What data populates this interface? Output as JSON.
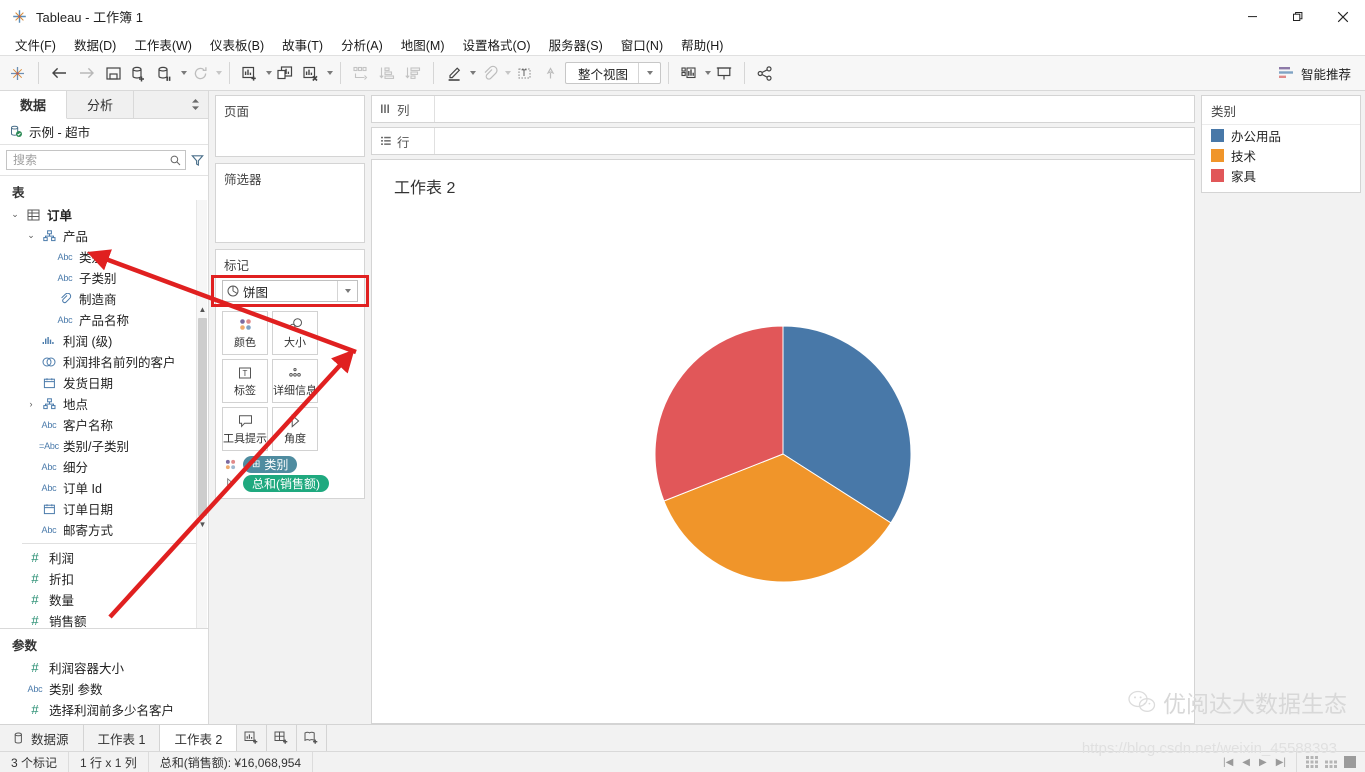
{
  "window": {
    "title": "Tableau - 工作簿 1",
    "logo_icon": "tableau-logo-icon",
    "minimize": "—",
    "maximize": "❐",
    "close": "✕"
  },
  "menubar": {
    "items": [
      {
        "label": "文件(F)"
      },
      {
        "label": "数据(D)"
      },
      {
        "label": "工作表(W)"
      },
      {
        "label": "仪表板(B)"
      },
      {
        "label": "故事(T)"
      },
      {
        "label": "分析(A)"
      },
      {
        "label": "地图(M)"
      },
      {
        "label": "设置格式(O)"
      },
      {
        "label": "服务器(S)"
      },
      {
        "label": "窗口(N)"
      },
      {
        "label": "帮助(H)"
      }
    ]
  },
  "toolbar": {
    "fit_label": "整个视图",
    "smart_label": "智能推荐",
    "buttons": [
      {
        "name": "tableau-home-icon"
      },
      {
        "name": "undo-icon"
      },
      {
        "name": "redo-icon"
      },
      {
        "name": "save-icon"
      },
      {
        "name": "new-data-source-icon"
      },
      {
        "name": "pause-refresh-icon"
      },
      {
        "name": "refresh-data-source-icon"
      },
      {
        "name": "new-worksheet-icon"
      },
      {
        "name": "duplicate-sheet-icon"
      },
      {
        "name": "clear-sheet-icon"
      },
      {
        "name": "swap-rows-columns-icon"
      },
      {
        "name": "sort-ascending-icon"
      },
      {
        "name": "sort-descending-icon"
      },
      {
        "name": "highlight-icon"
      },
      {
        "name": "group-members-icon"
      },
      {
        "name": "show-mark-labels-icon"
      },
      {
        "name": "fix-axes-icon"
      },
      {
        "name": "show-hide-cards-icon"
      },
      {
        "name": "presentation-mode-icon"
      },
      {
        "name": "share-icon"
      }
    ]
  },
  "data_pane": {
    "tab_data": "数据",
    "tab_analytics": "分析",
    "datasource": "示例 - 超市",
    "datasource_icon": "database-icon",
    "search_placeholder": "搜索",
    "search_value": "",
    "search_icon": "search-icon",
    "filter_icon": "funnel-icon",
    "grid_icon": "grid-view-icon",
    "dropdown_icon": "chevron-down-icon",
    "tables_label": "表",
    "parameters_label": "参数",
    "fields": [
      {
        "label": "订单",
        "icon": "table-icon",
        "indent": 0,
        "twisty": "down",
        "bold": true
      },
      {
        "label": "产品",
        "icon": "hierarchy-icon",
        "indent": 1,
        "twisty": "down",
        "bold": false
      },
      {
        "label": "类别",
        "icon": "abc",
        "indent": 2,
        "twisty": "",
        "bold": false
      },
      {
        "label": "子类别",
        "icon": "abc",
        "indent": 2,
        "twisty": "",
        "bold": false
      },
      {
        "label": "制造商",
        "icon": "link-icon",
        "indent": 2,
        "twisty": "",
        "bold": false
      },
      {
        "label": "产品名称",
        "icon": "abc",
        "indent": 2,
        "twisty": "",
        "bold": false
      },
      {
        "label": "利润 (级)",
        "icon": "bin-icon",
        "indent": 1,
        "twisty": "",
        "bold": false
      },
      {
        "label": "利润排名前列的客户",
        "icon": "set-icon",
        "indent": 1,
        "twisty": "",
        "bold": false
      },
      {
        "label": "发货日期",
        "icon": "calendar-icon",
        "indent": 1,
        "twisty": "",
        "bold": false
      },
      {
        "label": "地点",
        "icon": "hierarchy-icon",
        "indent": 1,
        "twisty": "right",
        "bold": false
      },
      {
        "label": "客户名称",
        "icon": "abc",
        "indent": 1,
        "twisty": "",
        "bold": false
      },
      {
        "label": "类别/子类别",
        "icon": "eq-abc",
        "indent": 1,
        "twisty": "",
        "bold": false
      },
      {
        "label": "细分",
        "icon": "abc",
        "indent": 1,
        "twisty": "",
        "bold": false
      },
      {
        "label": "订单 Id",
        "icon": "abc",
        "indent": 1,
        "twisty": "",
        "bold": false
      },
      {
        "label": "订单日期",
        "icon": "calendar-icon",
        "indent": 1,
        "twisty": "",
        "bold": false
      },
      {
        "label": "邮寄方式",
        "icon": "abc",
        "indent": 1,
        "twisty": "",
        "bold": false
      }
    ],
    "measures": [
      {
        "label": "利润",
        "icon": "hash-icon"
      },
      {
        "label": "折扣",
        "icon": "hash-icon"
      },
      {
        "label": "数量",
        "icon": "hash-icon"
      },
      {
        "label": "销售额",
        "icon": "hash-icon"
      }
    ],
    "parameters": [
      {
        "label": "利润容器大小",
        "icon": "hash-icon"
      },
      {
        "label": "类别 参数",
        "icon": "abc"
      },
      {
        "label": "选择利润前多少名客户",
        "icon": "hash-icon"
      }
    ]
  },
  "cards": {
    "pages_label": "页面",
    "filters_label": "筛选器",
    "marks_label": "标记",
    "mark_type": "饼图",
    "mark_type_icon": "pie-icon",
    "mark_type_dropdown_icon": "chevron-down-icon",
    "buttons": [
      {
        "label": "颜色",
        "icon": "color-icon"
      },
      {
        "label": "大小",
        "icon": "size-icon"
      },
      {
        "label": "标签",
        "icon": "label-icon"
      },
      {
        "label": "详细信息",
        "icon": "detail-icon"
      },
      {
        "label": "工具提示",
        "icon": "tooltip-icon"
      },
      {
        "label": "角度",
        "icon": "angle-icon"
      }
    ],
    "pills": [
      {
        "label": "类别",
        "kind": "dim",
        "shelf_icon": "color-icon",
        "pill_icon": "plus-box-icon"
      },
      {
        "label": "总和(销售额)",
        "kind": "meas",
        "shelf_icon": "angle-icon",
        "pill_icon": ""
      }
    ]
  },
  "shelves": {
    "columns_label": "列",
    "columns_icon": "columns-icon",
    "columns_value": "",
    "rows_label": "行",
    "rows_icon": "rows-icon",
    "rows_value": ""
  },
  "view": {
    "worksheet_title": "工作表 2"
  },
  "legend": {
    "title": "类别",
    "items": [
      {
        "label": "办公用品",
        "color": "#4878a8"
      },
      {
        "label": "技术",
        "color": "#f0952a"
      },
      {
        "label": "家具",
        "color": "#e15759"
      }
    ]
  },
  "chart_data": {
    "type": "pie",
    "title": "工作表 2",
    "labels": [
      "办公用品",
      "技术",
      "家具"
    ],
    "values": [
      5470000,
      5620000,
      4978954
    ],
    "percents": [
      34.0,
      35.0,
      31.0
    ],
    "colors": [
      "#4878a8",
      "#f0952a",
      "#e15759"
    ],
    "start_angle_deg": 0,
    "legend_position": "right",
    "legend_title": "类别",
    "total_label": "总和(销售额): ¥16,068,954"
  },
  "sheet_tabs": {
    "datasource_label": "数据源",
    "datasource_icon": "database-icon",
    "tabs": [
      {
        "label": "工作表 1",
        "active": false
      },
      {
        "label": "工作表 2",
        "active": true
      }
    ],
    "add_buttons": [
      {
        "name": "new-worksheet-icon"
      },
      {
        "name": "new-dashboard-icon"
      },
      {
        "name": "new-story-icon"
      }
    ]
  },
  "status_bar": {
    "marks": "3 个标记",
    "dimensions": "1 行 x 1 列",
    "total": "总和(销售额): ¥16,068,954",
    "nav_icons": [
      "first-page-icon",
      "prev-page-icon",
      "next-page-icon",
      "last-page-icon"
    ],
    "view_icons": [
      "grid-view-icon",
      "small-grid-icon",
      "single-view-icon"
    ]
  },
  "watermark": {
    "brand": "优阅达大数据生态",
    "url": "https://blog.csdn.net/weixin_45588393",
    "logo_icon": "wechat-icon"
  },
  "annotations": {
    "arrow1_from": "类别 field",
    "arrow2_from": "销售额 field"
  }
}
